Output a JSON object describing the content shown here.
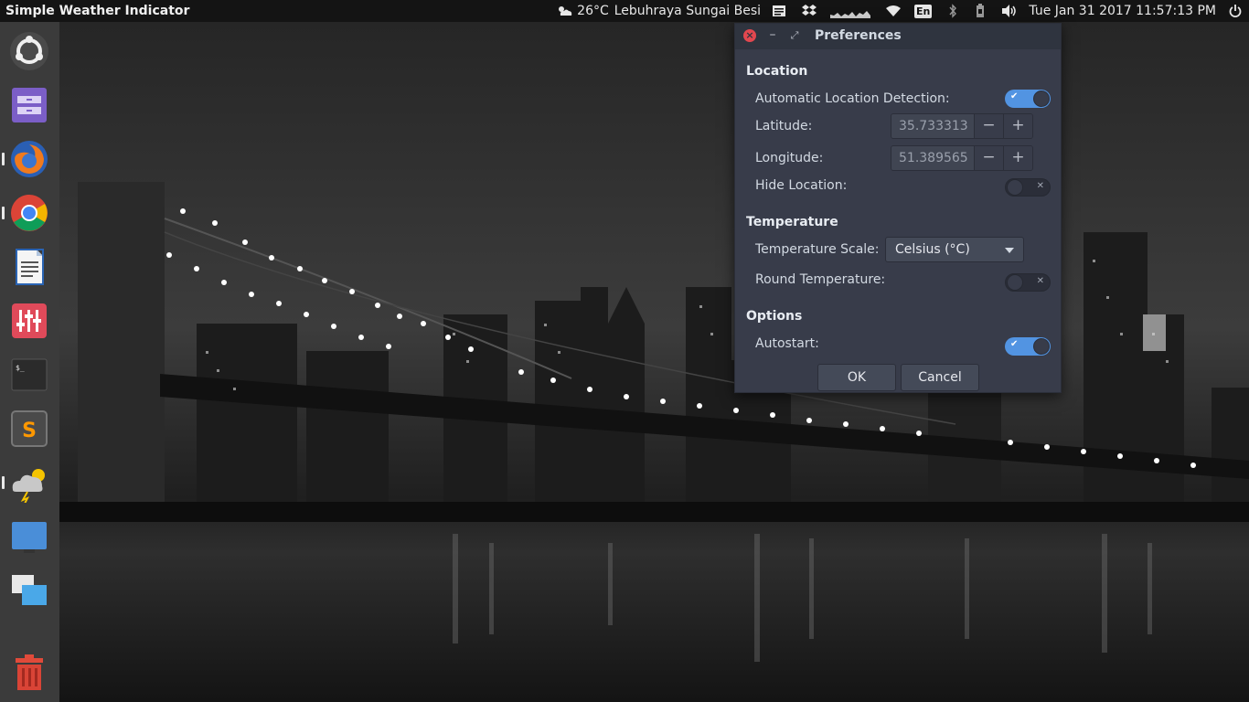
{
  "top_panel": {
    "app_title": "Simple Weather Indicator",
    "weather_temp": "26°C",
    "weather_location": "Lebuhraya Sungai Besi",
    "keyboard_layout": "En",
    "datetime": "Tue Jan 31 2017 11:57:13 PM",
    "icons": [
      "weather-icon",
      "notes-icon",
      "dropbox-icon",
      "network-graph-icon",
      "wifi-icon",
      "keyboard-icon",
      "bluetooth-icon",
      "battery-icon",
      "volume-icon",
      "power-icon"
    ]
  },
  "launcher": {
    "items": [
      "ubuntu-dash",
      "files-cabinet",
      "firefox",
      "chrome",
      "libreoffice-writer",
      "mixer-settings",
      "terminal",
      "sublime-text",
      "weather-indicator",
      "workspace-switcher",
      "windows-spread",
      "trash"
    ],
    "sublime_letter": "S"
  },
  "dialog": {
    "title": "Preferences",
    "sections": {
      "location": "Location",
      "temperature": "Temperature",
      "options": "Options"
    },
    "auto_detect_label": "Automatic Location Detection:",
    "auto_detect_on": true,
    "latitude_label": "Latitude:",
    "latitude_value": "35.733313",
    "longitude_label": "Longitude:",
    "longitude_value": "51.389565",
    "hide_location_label": "Hide Location:",
    "hide_location_on": false,
    "temp_scale_label": "Temperature Scale:",
    "temp_scale_value": "Celsius (°C)",
    "round_temp_label": "Round Temperature:",
    "round_temp_on": false,
    "autostart_label": "Autostart:",
    "autostart_on": true,
    "ok_label": "OK",
    "cancel_label": "Cancel"
  },
  "colors": {
    "accent": "#5294e2",
    "dialog_bg": "#383c4a",
    "titlebar_bg": "#2f343f",
    "close_red": "#e2474f"
  }
}
